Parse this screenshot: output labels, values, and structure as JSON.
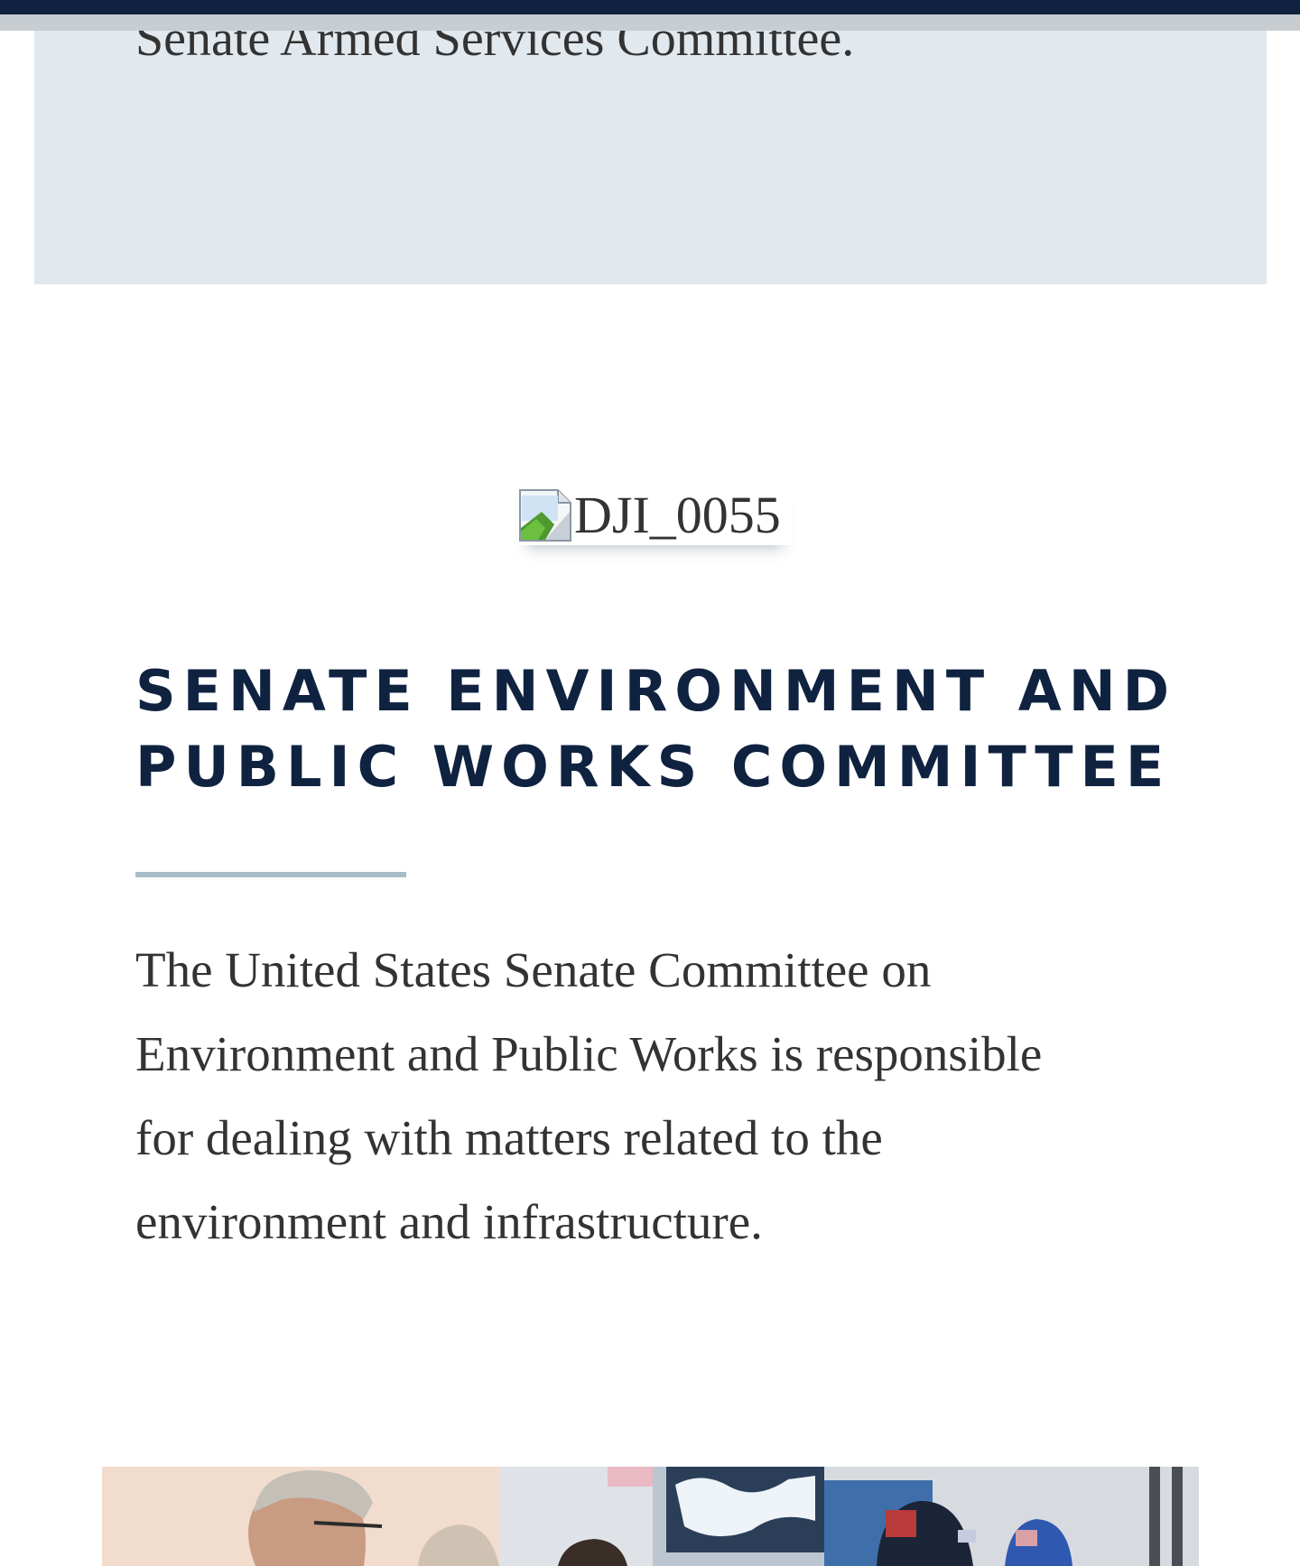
{
  "previous_card": {
    "text": "Senate Armed Services Committee."
  },
  "image": {
    "alt": "DJI_0055",
    "icon": "broken-image-icon"
  },
  "section": {
    "title_line1": "SENATE ENVIRONMENT AND",
    "title_line2": "PUBLIC WORKS COMMITTEE",
    "description_lines": [
      "The United States Senate Committee on",
      "Environment and Public Works is responsible",
      "for dealing with matters related to the",
      "environment and infrastructure."
    ]
  },
  "next_card": {
    "photo": "people-photo"
  },
  "colors": {
    "navy": "#0f2240",
    "card_bg": "#e1e8ee",
    "divider": "#a9bdc7",
    "body_text": "#333333"
  }
}
